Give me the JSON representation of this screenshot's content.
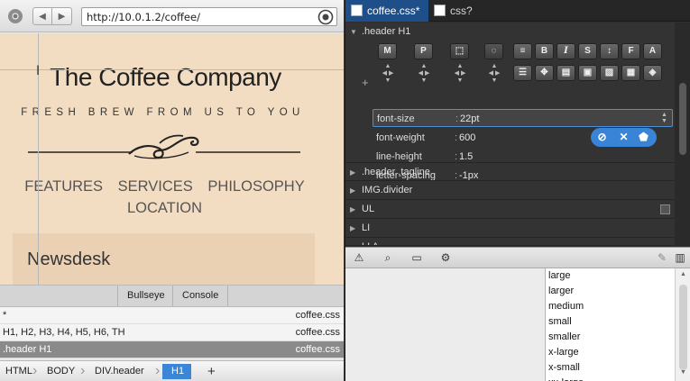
{
  "browser": {
    "url": "http://10.0.1.2/coffee/"
  },
  "site": {
    "title": "The Coffee Company",
    "tagline": "FRESH BREW FROM US TO YOU",
    "nav": [
      "FEATURES",
      "SERVICES",
      "PHILOSOPHY",
      "LOCATION"
    ],
    "section_title": "Newsdesk"
  },
  "bottom_tabs": [
    "Bullseye",
    "Console"
  ],
  "rules": [
    {
      "selector": "*",
      "file": "coffee.css",
      "selected": false
    },
    {
      "selector": "H1, H2, H3, H4, H5, H6, TH",
      "file": "coffee.css",
      "selected": false
    },
    {
      "selector": ".header H1",
      "file": "coffee.css",
      "selected": true
    }
  ],
  "breadcrumbs": [
    "HTML",
    "BODY",
    "DIV.header",
    "H1"
  ],
  "editor": {
    "tabs": [
      "coffee.css*",
      "css?"
    ],
    "current_selector": ".header H1",
    "tool_buttons": [
      "M",
      "P",
      "B",
      "I",
      "S",
      "F"
    ],
    "properties": [
      {
        "name": "font-size",
        "value": "22pt"
      },
      {
        "name": "font-weight",
        "value": "600"
      },
      {
        "name": "line-height",
        "value": "1.5"
      },
      {
        "name": "letter-spacing",
        "value": "-1px"
      }
    ],
    "other_selectors": [
      ".header .tagline",
      "IMG.divider",
      "UL",
      "LI",
      "LI A"
    ],
    "hints": [
      "large",
      "larger",
      "medium",
      "small",
      "smaller",
      "x-large",
      "x-small",
      "xx-large"
    ]
  },
  "colors": {
    "page_bg": "#f3ddc2",
    "selection_blue": "#3c86d6",
    "active_tab": "#1f4f88",
    "editor_bg": "#333333"
  }
}
